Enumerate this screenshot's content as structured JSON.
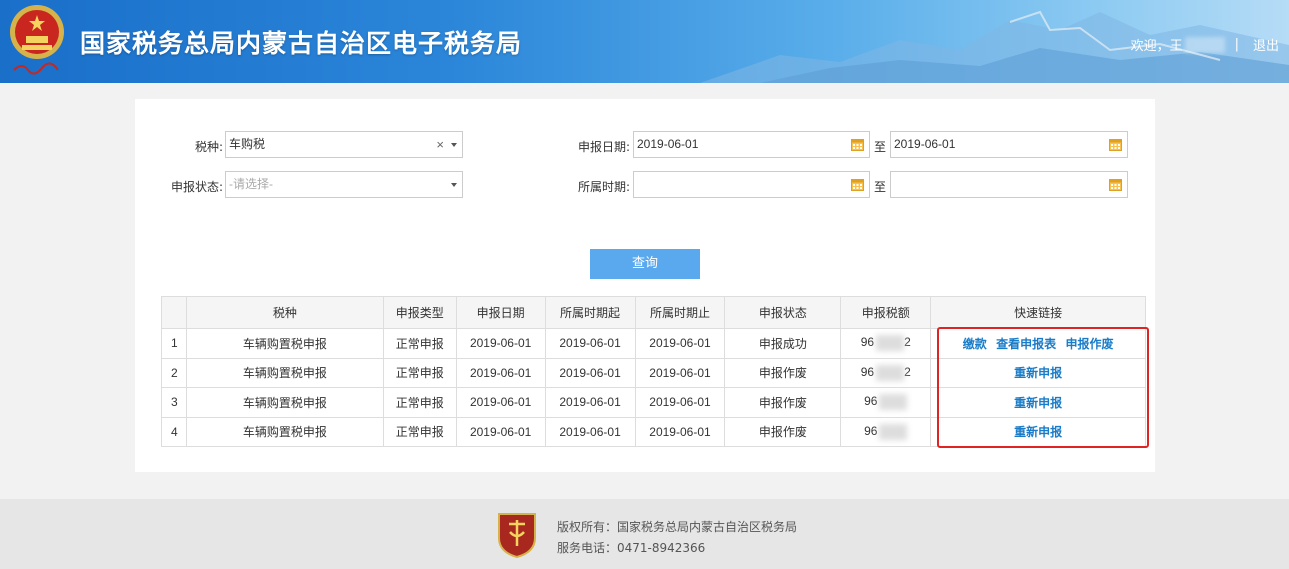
{
  "header": {
    "site_title": "国家税务总局内蒙古自治区电子税务局",
    "welcome": "欢迎，",
    "user_initial": "王",
    "separator": "|",
    "logout": "退出"
  },
  "filters": {
    "tax_type_label": "税种:",
    "tax_type_value": "车购税",
    "tax_type_clear": "×",
    "declare_status_label": "申报状态:",
    "declare_status_placeholder": "-请选择-",
    "declare_date_label": "申报日期:",
    "declare_date_from": "2019-06-01",
    "declare_date_to": "2019-06-01",
    "period_label": "所属时期:",
    "period_from": "",
    "period_to": "",
    "to_text": "至"
  },
  "query_button": "查询",
  "table": {
    "columns": [
      "",
      "税种",
      "申报类型",
      "申报日期",
      "所属时期起",
      "所属时期止",
      "申报状态",
      "申报税额",
      "快速链接"
    ],
    "rows": [
      {
        "no": "1",
        "tax": "车辆购置税申报",
        "type": "正常申报",
        "date": "2019-06-01",
        "start": "2019-06-01",
        "end": "2019-06-01",
        "status": "申报成功",
        "amount_prefix": "96",
        "amount_suffix": "2",
        "links": [
          "缴款",
          "查看申报表",
          "申报作废"
        ]
      },
      {
        "no": "2",
        "tax": "车辆购置税申报",
        "type": "正常申报",
        "date": "2019-06-01",
        "start": "2019-06-01",
        "end": "2019-06-01",
        "status": "申报作废",
        "amount_prefix": "96",
        "amount_suffix": "2",
        "links": [
          "重新申报"
        ]
      },
      {
        "no": "3",
        "tax": "车辆购置税申报",
        "type": "正常申报",
        "date": "2019-06-01",
        "start": "2019-06-01",
        "end": "2019-06-01",
        "status": "申报作废",
        "amount_prefix": "96",
        "amount_suffix": "",
        "links": [
          "重新申报"
        ]
      },
      {
        "no": "4",
        "tax": "车辆购置税申报",
        "type": "正常申报",
        "date": "2019-06-01",
        "start": "2019-06-01",
        "end": "2019-06-01",
        "status": "申报作废",
        "amount_prefix": "96",
        "amount_suffix": "",
        "links": [
          "重新申报"
        ]
      }
    ]
  },
  "footer": {
    "copyright": "版权所有：国家税务总局内蒙古自治区税务局",
    "phone": "服务电话：0471-8942366"
  },
  "icons": {
    "emblem": "national-emblem-icon",
    "calendar": "calendar-icon",
    "footer_logo": "tax-shield-logo-icon"
  },
  "colors": {
    "accent": "#5aa9ef",
    "link": "#1a7cc8",
    "highlight": "#e02424",
    "header_start": "#1a6fc9"
  }
}
